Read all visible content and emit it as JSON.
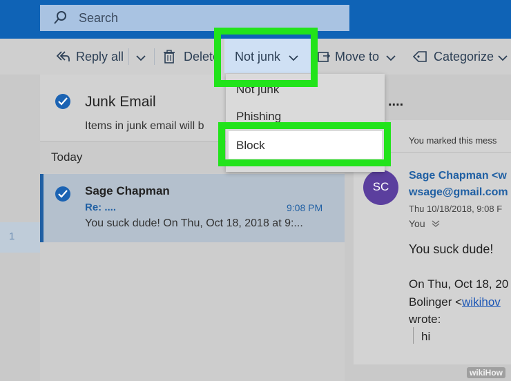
{
  "search": {
    "placeholder": "Search"
  },
  "toolbar": {
    "reply_all": "Reply all",
    "delete": "Delete",
    "not_junk": "Not junk",
    "move_to": "Move to",
    "categorize": "Categorize"
  },
  "dropdown": {
    "items": [
      "Not junk",
      "Phishing",
      "Block"
    ]
  },
  "folder": {
    "title": "Junk Email",
    "subtitle": "Items in junk email will b",
    "dots": "...."
  },
  "list": {
    "group": "Today",
    "item": {
      "sender": "Sage Chapman",
      "subject": "Re: ....",
      "time": "9:08 PM",
      "preview": "You suck dude! On Thu, Oct 18, 2018 at 9:..."
    }
  },
  "rail": {
    "count": "1"
  },
  "reading": {
    "banner": "You marked this mess",
    "initials": "SC",
    "from_name": "Sage Chapman <w",
    "from_email": "wsage@gmail.com",
    "date": "Thu 10/18/2018, 9:08 F",
    "to": "You",
    "body1": "You suck dude!",
    "body2": "On Thu, Oct 18, 20",
    "body3a": "Bolinger <",
    "body3link": "wikihov",
    "body4": "wrote:",
    "quote": "hi"
  },
  "watermark": "wikiHow",
  "colors": {
    "header_blue": "#0f63b6",
    "highlight_green": "#22e31b",
    "avatar_purple": "#5b3f9e",
    "selected_bg": "#b4c0cd"
  },
  "icons": [
    "search-icon",
    "reply-all-icon",
    "trash-icon",
    "chevron-down-icon",
    "move-to-icon",
    "tag-icon",
    "check-circle-icon",
    "expand-chevron-icon"
  ]
}
